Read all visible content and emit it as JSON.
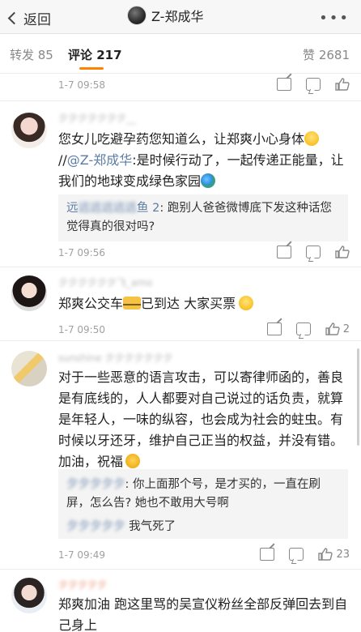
{
  "header": {
    "back_label": "返回",
    "title": "Z-郑成华",
    "more_label": "•••"
  },
  "tabs": {
    "forward": "转发 85",
    "comments": "评论 217",
    "likes": "赞 2681"
  },
  "colors": {
    "accent": "#ff8200",
    "link": "#5b7ca6"
  },
  "comments": [
    {
      "time": "1-7 09:58"
    },
    {
      "name": "",
      "text_a": "您女儿吃避孕药您知道么，让郑爽小心身体",
      "text_b": "//",
      "mention": "@Z-郑成华",
      "text_c": ":是时候行动了，一起传递正能量，让我们的地球变成绿色家园",
      "reply_name": "远",
      "reply_name2": "鱼 2",
      "reply_text": ": 跑别人爸爸微博底下发这种话您觉得真的很对吗?",
      "time": "1-7 09:56"
    },
    {
      "name": "",
      "text_a": "郑爽公交车",
      "text_b": "已到达  大家买票",
      "time": "1-7 09:50",
      "likes": "2"
    },
    {
      "name": "",
      "text": "对于一些恶意的语言攻击，可以寄律师函的，善良是有底线的，人人都要对自己说过的话负责，就算是年轻人，一味的纵容，也会成为社会的蛀虫。有时候以牙还牙，维护自己正当的权益，并没有错。加油，祝福",
      "reply1_text": ": 你上面那个号，是才买的，一直在刷屏，怎么告? 她也不敢用大号啊",
      "reply2_text": " 我气死了",
      "time": "1-7 09:49",
      "likes": "23"
    },
    {
      "name": "",
      "text": "郑爽加油 跑这里骂的吴宣仪粉丝全部反弹回去到自己身上"
    }
  ]
}
